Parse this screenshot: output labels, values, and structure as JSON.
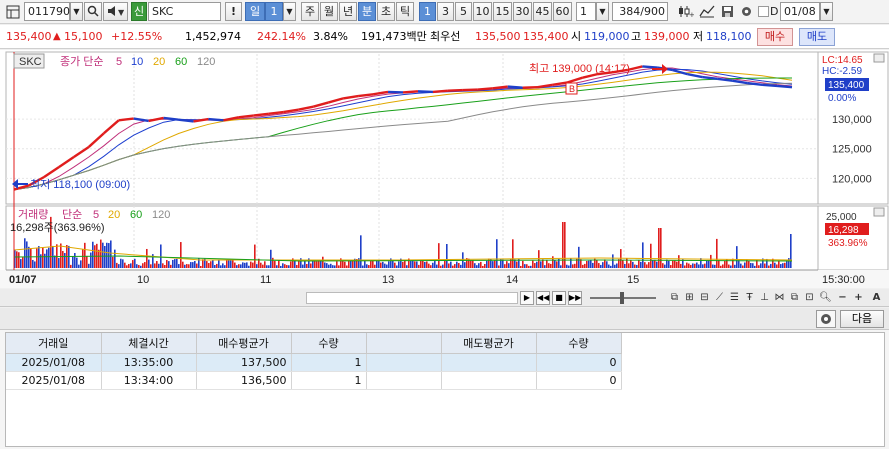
{
  "toolbar": {
    "code": "011790",
    "name_badge": "신",
    "name": "SKC",
    "warning": "!",
    "period_day": "일",
    "period_num": "1",
    "period_week": "주",
    "period_month": "월",
    "period_year": "년",
    "period_minute": "분",
    "period_second": "초",
    "period_tick": "틱",
    "intervals": [
      "1",
      "3",
      "5",
      "10",
      "15",
      "30",
      "45",
      "60"
    ],
    "count_value": "1",
    "bars_shown": "384",
    "bars_total": "/900",
    "date_flag": "D",
    "date": "01/08"
  },
  "price": {
    "current": "135,400",
    "change": "15,100",
    "change_pct": "+12.55%",
    "volume": "1,452,974",
    "volume_ratio": "242.14%",
    "turnover_rate": "3.84%",
    "amount": "191,473백만",
    "best_label": "최우선",
    "best_ask": "135,500",
    "best_bid": "135,400",
    "open_label": "시",
    "open": "119,000",
    "high_label": "고",
    "high": "139,000",
    "low_label": "저",
    "low": "118,100",
    "buy_label": "매수",
    "sell_label": "매도"
  },
  "chart": {
    "symbol": "SKC",
    "ma_title": "종가 단순",
    "ma_periods": [
      "5",
      "10",
      "20",
      "60",
      "120"
    ],
    "ma_colors": [
      "#c0307a",
      "#1d3fd0",
      "#e0a800",
      "#19a01a",
      "#8a8a8a"
    ],
    "lc_label": "LC:14.65",
    "hc_label": "HC:-2.59",
    "last_price_label": "135,400",
    "last_pct_label": "0.00%",
    "high_annotation": "최고 139,000 (14:17)",
    "low_annotation": "최저 118,100 (09:00)",
    "y_ticks": [
      "130,000",
      "125,000",
      "120,000"
    ],
    "x_ticks": [
      "01/07",
      "10",
      "11",
      "13",
      "14",
      "15",
      "15:30:00"
    ],
    "volume_title": "거래량",
    "volume_ma_title": "단순",
    "volume_ma_periods": [
      "5",
      "20",
      "60",
      "120"
    ],
    "volume_ma_colors": [
      "#c0307a",
      "#e0a800",
      "#19a01a",
      "#8a8a8a"
    ],
    "volume_label": "16,298주(363.96%)",
    "volume_ytick": "25,000",
    "volume_last": "16,298",
    "volume_last_pct": "363.96%",
    "up_color": "#e01d1d",
    "down_color": "#1f3fc8"
  },
  "chart_data": {
    "type": "line",
    "title": "",
    "ylim": [
      116000,
      141000
    ],
    "series": [
      {
        "name": "SKC",
        "values": [
          118100,
          118800,
          120200,
          121900,
          123600,
          125300,
          127600,
          129800,
          130100,
          129700,
          130200,
          129900,
          129600,
          130000,
          129800,
          130300,
          130600,
          130900,
          131200,
          131600,
          132100,
          132800,
          133500,
          133900,
          134200,
          134600,
          134500,
          134700,
          134600,
          134800,
          134900,
          135000,
          135200,
          135500,
          135300,
          135400,
          135800,
          136200,
          137000,
          137600,
          137900,
          138300,
          138900,
          138700,
          138300,
          137600,
          137100,
          136800,
          136500,
          136100,
          135800,
          135600,
          135400
        ]
      }
    ],
    "volume_ylim": [
      0,
      30000
    ]
  },
  "trade": {
    "next_label": "다음",
    "headers": [
      "거래일",
      "체결시간",
      "매수평균가",
      "수량",
      "",
      "매도평균가",
      "수량"
    ],
    "rows": [
      [
        "2025/01/08",
        "13:35:00",
        "137,500",
        "1",
        "",
        "",
        "0"
      ],
      [
        "2025/01/08",
        "13:34:00",
        "136,500",
        "1",
        "",
        "",
        "0"
      ]
    ]
  }
}
